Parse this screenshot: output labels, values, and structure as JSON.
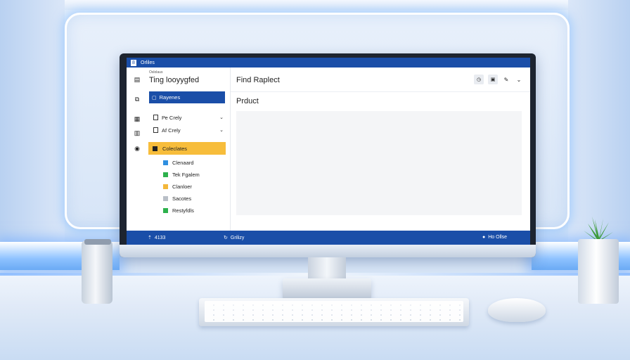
{
  "window": {
    "title": "Orliles"
  },
  "rail": {
    "icons": [
      "grid-icon",
      "page-icon",
      "table-icon",
      "document-icon",
      "settings-icon"
    ]
  },
  "sidebar": {
    "small_caption": "Oslolaus",
    "heading": "Ting lооyygfed",
    "selected_item": "Rayenes",
    "rows": [
      {
        "label": "Ре Crely"
      },
      {
        "label": "Af Crely"
      }
    ],
    "highlight_item": "Coleclates",
    "sub_items": [
      {
        "label": "Clenaard",
        "color": "#2f8fe0"
      },
      {
        "label": "Tek Fgalem",
        "color": "#2db14c"
      },
      {
        "label": "Clanloer",
        "color": "#f3b73a"
      },
      {
        "label": "Sacotes",
        "color": "#b9bfc7"
      },
      {
        "label": "Restyfdls",
        "color": "#2db14c"
      }
    ]
  },
  "main": {
    "title": "Find Raplect",
    "label": "Prduct",
    "tools": [
      "history-icon",
      "save-icon",
      "edit-icon",
      "chevron-down-icon"
    ]
  },
  "statusbar": {
    "left": "4133",
    "middle": "Grilizy",
    "right": "Ho Ollse"
  },
  "colors": {
    "accent": "#1a4ea8",
    "highlight": "#f7bd3b"
  }
}
